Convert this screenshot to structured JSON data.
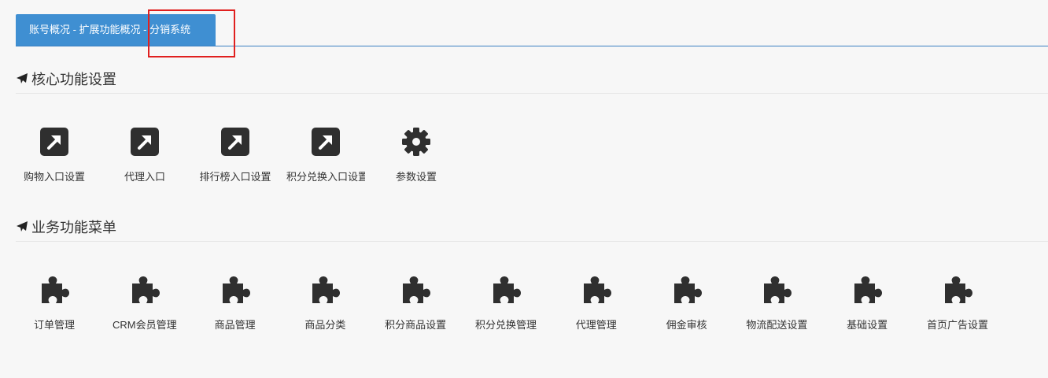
{
  "tab": {
    "label": "账号概况 - 扩展功能概况 - 分销系统"
  },
  "sections": {
    "core": {
      "title": "核心功能设置",
      "icon": "plane-icon",
      "items": [
        {
          "label": "购物入口设置",
          "icon": "external-link-icon"
        },
        {
          "label": "代理入口",
          "icon": "external-link-icon"
        },
        {
          "label": "排行榜入口设置",
          "icon": "external-link-icon"
        },
        {
          "label": "积分兑换入口设置",
          "icon": "external-link-icon"
        },
        {
          "label": "参数设置",
          "icon": "gear-icon"
        }
      ]
    },
    "business": {
      "title": "业务功能菜单",
      "icon": "plane-icon",
      "items": [
        {
          "label": "订单管理",
          "icon": "puzzle-icon"
        },
        {
          "label": "CRM会员管理",
          "icon": "puzzle-icon"
        },
        {
          "label": "商品管理",
          "icon": "puzzle-icon"
        },
        {
          "label": "商品分类",
          "icon": "puzzle-icon"
        },
        {
          "label": "积分商品设置",
          "icon": "puzzle-icon"
        },
        {
          "label": "积分兑换管理",
          "icon": "puzzle-icon"
        },
        {
          "label": "代理管理",
          "icon": "puzzle-icon"
        },
        {
          "label": "佣金审核",
          "icon": "puzzle-icon"
        },
        {
          "label": "物流配送设置",
          "icon": "puzzle-icon"
        },
        {
          "label": "基础设置",
          "icon": "puzzle-icon"
        },
        {
          "label": "首页广告设置",
          "icon": "puzzle-icon"
        }
      ]
    }
  },
  "colors": {
    "tab_bg": "#3f8fd2",
    "tab_border": "#3c80c1",
    "highlight": "#e0201f",
    "icon": "#2f2f2f"
  }
}
